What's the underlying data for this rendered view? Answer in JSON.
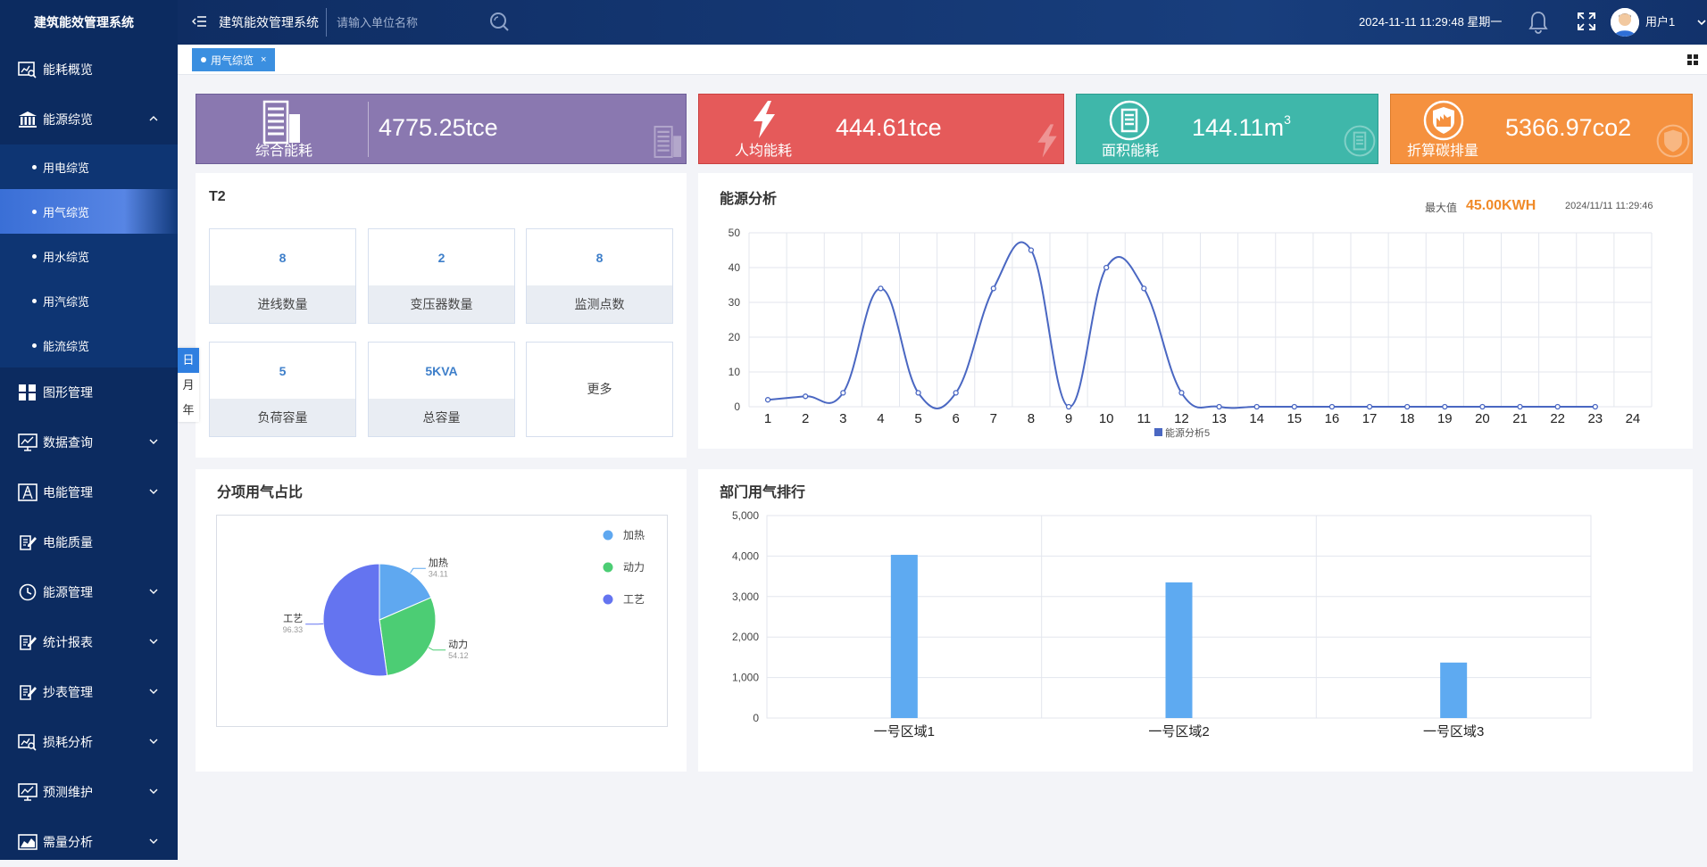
{
  "app": {
    "title": "建筑能效管理系统"
  },
  "sidebar": {
    "items": [
      {
        "label": "能耗概览",
        "icon": "search-chart-icon",
        "chevron": false
      },
      {
        "label": "能源综览",
        "icon": "bank-icon",
        "chevron": "up"
      },
      {
        "label": "图形管理",
        "icon": "grid-icon",
        "chevron": false
      },
      {
        "label": "数据查询",
        "icon": "monitor-chart-icon",
        "chevron": "down"
      },
      {
        "label": "电能管理",
        "icon": "electric-tower-icon",
        "chevron": "down"
      },
      {
        "label": "电能质量",
        "icon": "edit-document-icon",
        "chevron": false
      },
      {
        "label": "能源管理",
        "icon": "clock-icon",
        "chevron": "down"
      },
      {
        "label": "统计报表",
        "icon": "report-edit-icon",
        "chevron": "down"
      },
      {
        "label": "抄表管理",
        "icon": "meter-edit-icon",
        "chevron": "down"
      },
      {
        "label": "损耗分析",
        "icon": "search-chart-icon",
        "chevron": "down"
      },
      {
        "label": "预测维护",
        "icon": "monitor-chart-icon",
        "chevron": "down"
      },
      {
        "label": "需量分析",
        "icon": "area-chart-icon",
        "chevron": "down"
      }
    ],
    "submenu": [
      {
        "label": "用电综览",
        "active": false
      },
      {
        "label": "用气综览",
        "active": true
      },
      {
        "label": "用水综览",
        "active": false
      },
      {
        "label": "用汽综览",
        "active": false
      },
      {
        "label": "能流综览",
        "active": false
      }
    ]
  },
  "topbar": {
    "system_name": "建筑能效管理系统",
    "search_placeholder": "请输入单位名称",
    "datetime": "2024-11-11 11:29:48 星期一",
    "username": "用户1"
  },
  "tabs": [
    {
      "label": "用气综览",
      "close": "×"
    }
  ],
  "period_switch": [
    {
      "label": "日",
      "active": true
    },
    {
      "label": "月",
      "active": false
    },
    {
      "label": "年",
      "active": false
    }
  ],
  "stats": [
    {
      "label": "综合能耗",
      "value": "4775.25tce",
      "color": "#8a78b0",
      "icon": "building-icon"
    },
    {
      "label": "人均能耗",
      "value": "444.61tce",
      "color": "#e55a5a",
      "icon": "lightning-icon"
    },
    {
      "label": "面积能耗",
      "value": "144.11m",
      "sup": "3",
      "color": "#3fb7aa",
      "icon": "document-list-icon"
    },
    {
      "label": "折算碳排量",
      "value": "5366.97co2",
      "color": "#f5913f",
      "icon": "factory-shield-icon"
    }
  ],
  "t2": {
    "title": "T2",
    "tiles": [
      {
        "value": "8",
        "caption": "进线数量"
      },
      {
        "value": "2",
        "caption": "变压器数量"
      },
      {
        "value": "8",
        "caption": "监测点数"
      },
      {
        "value": "5",
        "caption": "负荷容量"
      },
      {
        "value": "5KVA",
        "caption": "总容量"
      }
    ],
    "more": "更多"
  },
  "energy_analysis": {
    "title": "能源分析",
    "max_label": "最大值",
    "max_value": "45.00KWH",
    "time": "2024/11/11 11:29:46"
  },
  "pie": {
    "title": "分项用气占比"
  },
  "ranking": {
    "title": "部门用气排行"
  },
  "chart_data": [
    {
      "type": "line",
      "series": [
        {
          "name": "能源分析5",
          "color": "#4a67c2",
          "values": [
            2,
            3,
            4,
            34,
            4,
            4,
            34,
            45,
            0,
            40,
            34,
            4,
            0,
            0,
            0,
            0,
            0,
            0,
            0,
            0,
            0,
            0,
            0
          ]
        }
      ],
      "x": [
        1,
        2,
        3,
        4,
        5,
        6,
        7,
        8,
        9,
        10,
        11,
        12,
        13,
        14,
        15,
        16,
        17,
        18,
        19,
        20,
        21,
        22,
        23
      ],
      "x_ticks": [
        1,
        2,
        3,
        4,
        5,
        6,
        7,
        8,
        9,
        10,
        11,
        12,
        13,
        14,
        15,
        16,
        17,
        18,
        19,
        20,
        21,
        22,
        23,
        24
      ],
      "y_ticks": [
        0,
        10,
        20,
        30,
        40,
        50
      ],
      "ylim": [
        0,
        50
      ],
      "xlim": [
        1,
        24
      ],
      "grid": true,
      "legend": "bottom"
    },
    {
      "type": "pie",
      "slices": [
        {
          "name": "加热",
          "value": 34.11,
          "color": "#5fa8f0"
        },
        {
          "name": "动力",
          "value": 54.12,
          "color": "#4ccd74"
        },
        {
          "name": "工艺",
          "value": 96.33,
          "color": "#6474f0"
        }
      ],
      "legend": "top-right"
    },
    {
      "type": "bar",
      "categories": [
        "一号区域1",
        "一号区域2",
        "一号区域3"
      ],
      "values": [
        4030,
        3350,
        1370
      ],
      "color": "#5eaaf1",
      "y_ticks": [
        "0",
        "1,000",
        "2,000",
        "3,000",
        "4,000",
        "5,000"
      ],
      "ylim": [
        0,
        5000
      ],
      "grid": true
    }
  ]
}
